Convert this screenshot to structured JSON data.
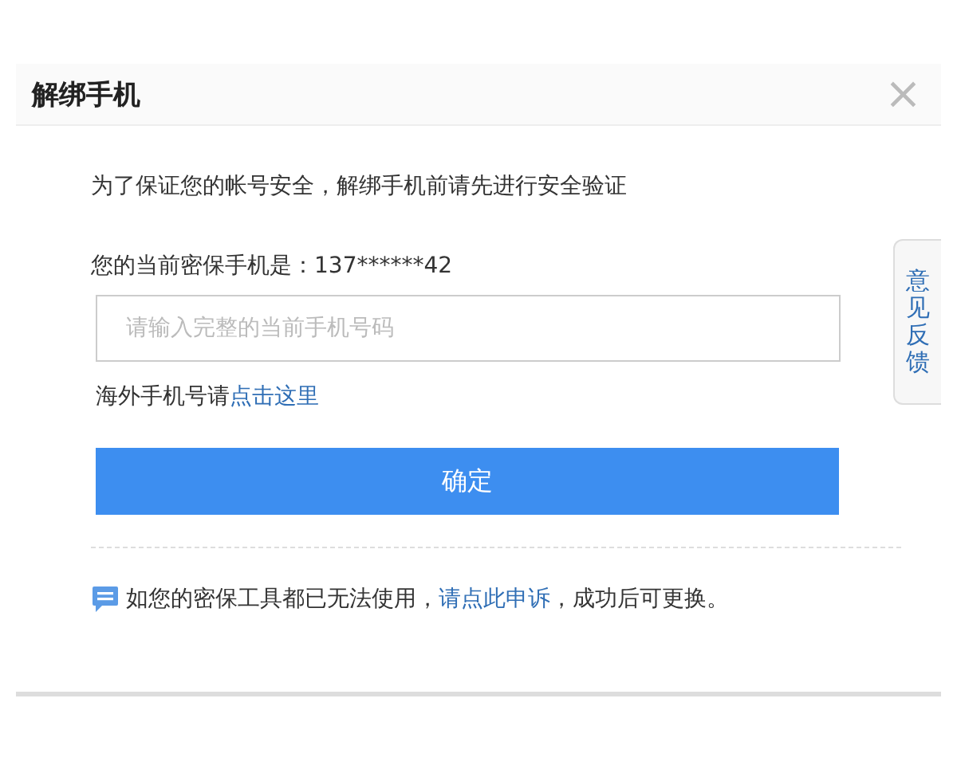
{
  "dialog": {
    "title": "解绑手机",
    "close": "×"
  },
  "intro": "为了保证您的帐号安全，解绑手机前请先进行安全验证",
  "current_phone": {
    "label": "您的当前密保手机是：",
    "value": "137******42"
  },
  "phone_field": {
    "placeholder": "请输入完整的当前手机号码"
  },
  "overseas": {
    "text": "海外手机号请",
    "link": "点击这里"
  },
  "confirm_button": "确定",
  "appeal": {
    "before": "如您的密保工具都已无法使用，",
    "link": "请点此申诉",
    "after": "，成功后可更换。"
  },
  "feedback_tab": "意见反馈"
}
